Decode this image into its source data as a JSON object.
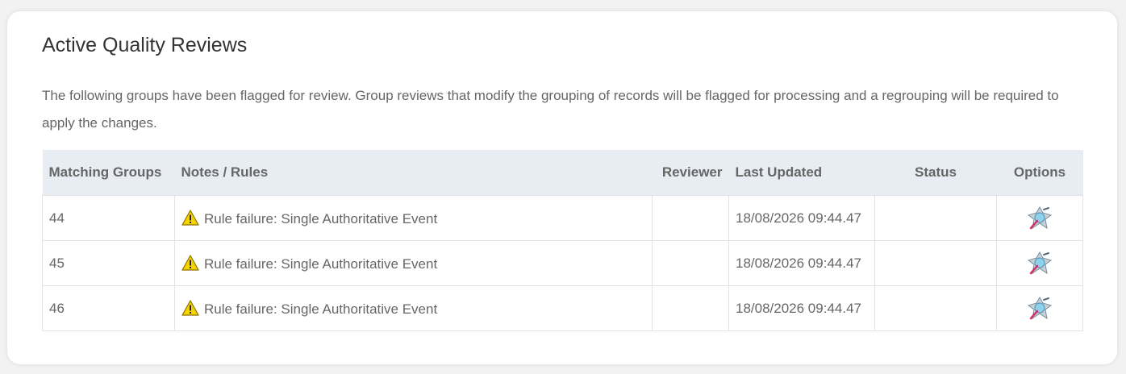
{
  "panel": {
    "title": "Active Quality Reviews",
    "description": "The following groups have been flagged for review. Group reviews that modify the grouping of records will be flagged for processing and a regrouping will be required to apply the changes."
  },
  "table": {
    "columns": [
      "Matching Groups",
      "Notes / Rules",
      "Reviewer",
      "Last Updated",
      "Status",
      "Options"
    ],
    "rows": [
      {
        "group": "44",
        "note": "Rule failure: Single Authoritative Event",
        "reviewer": "",
        "updated": "18/08/2026 09:44.47",
        "status": "",
        "note_icon": "warning-icon",
        "option_icon": "review-tool-icon"
      },
      {
        "group": "45",
        "note": "Rule failure: Single Authoritative Event",
        "reviewer": "",
        "updated": "18/08/2026 09:44.47",
        "status": "",
        "note_icon": "warning-icon",
        "option_icon": "review-tool-icon"
      },
      {
        "group": "46",
        "note": "Rule failure: Single Authoritative Event",
        "reviewer": "",
        "updated": "18/08/2026 09:44.47",
        "status": "",
        "note_icon": "warning-icon",
        "option_icon": "review-tool-icon"
      }
    ]
  },
  "colors": {
    "header_bg": "#e8edf4",
    "text": "#666666",
    "title": "#333333",
    "warning": "#f5d400"
  }
}
